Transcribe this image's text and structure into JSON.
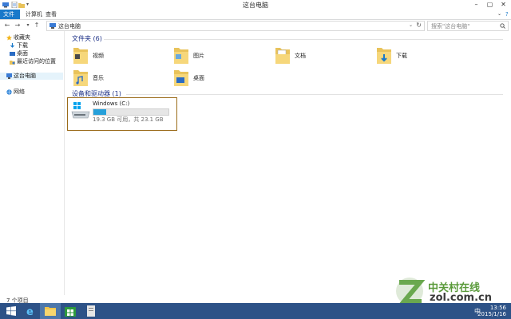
{
  "window": {
    "title": "这台电脑"
  },
  "ribbon": {
    "tabs": [
      "文件",
      "计算机",
      "查看"
    ]
  },
  "address": {
    "crumb": "这台电脑",
    "search_placeholder": "搜索\"这台电脑\""
  },
  "navpane": {
    "favorites": [
      "收藏夹",
      "下载",
      "桌面",
      "最近访问的位置"
    ],
    "this_pc": "这台电脑",
    "network": "网络"
  },
  "folders_group": {
    "header": "文件夹 (6)",
    "items": [
      {
        "label": "视频",
        "icon": "video-folder-icon"
      },
      {
        "label": "图片",
        "icon": "pictures-folder-icon"
      },
      {
        "label": "文档",
        "icon": "documents-folder-icon"
      },
      {
        "label": "下载",
        "icon": "downloads-folder-icon"
      },
      {
        "label": "音乐",
        "icon": "music-folder-icon"
      },
      {
        "label": "桌面",
        "icon": "desktop-folder-icon"
      }
    ]
  },
  "drives_group": {
    "header": "设备和驱动器 (1)",
    "drive": {
      "name": "Windows (C:)",
      "info": "19.3 GB 可用，共 23.1 GB",
      "used_fraction": 0.165
    }
  },
  "status": {
    "count": "7 个项目"
  },
  "watermark": {
    "cn": "中关村在线",
    "en": "zol.com.cn"
  },
  "taskbar": {
    "ime": "中",
    "time": "13:56",
    "date": "2015/1/16"
  },
  "colors": {
    "accent": "#1979ca",
    "taskbar": "#2d5287",
    "drive_bar": "#26a0da"
  }
}
